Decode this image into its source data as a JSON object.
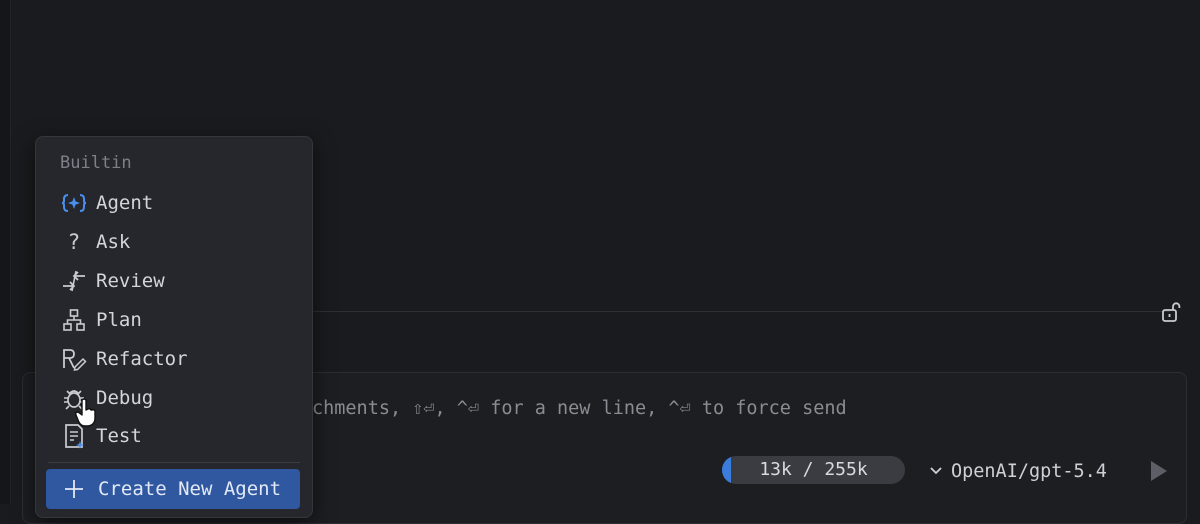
{
  "input": {
    "placeholder_visible": "chments, ⇧⏎, ^⏎ for a new line, ^⏎ to force send"
  },
  "context": {
    "label": "13k / 255k",
    "used_fraction": 0.051
  },
  "model": {
    "selected": "OpenAI/gpt-5.4"
  },
  "menu": {
    "header": "Builtin",
    "items": [
      {
        "label": "Agent",
        "icon": "agent-icon"
      },
      {
        "label": "Ask",
        "icon": "question-icon"
      },
      {
        "label": "Review",
        "icon": "review-arrows-icon"
      },
      {
        "label": "Plan",
        "icon": "plan-hierarchy-icon"
      },
      {
        "label": "Refactor",
        "icon": "refactor-icon"
      },
      {
        "label": "Debug",
        "icon": "bug-icon"
      },
      {
        "label": "Test",
        "icon": "test-document-icon"
      }
    ],
    "create_label": "Create New Agent"
  },
  "colors": {
    "accent": "#3b7ddd",
    "create_button": "#2f58a0",
    "background": "#1a1b1e",
    "menu_background": "#25272c"
  }
}
